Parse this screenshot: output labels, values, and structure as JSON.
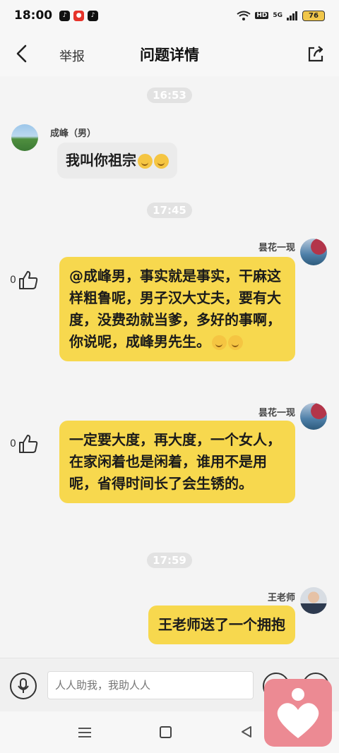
{
  "status": {
    "time": "18:00",
    "battery": "76",
    "hd": "HD",
    "signal": "5G"
  },
  "header": {
    "report_label": "举报",
    "title": "问题详情"
  },
  "timestamps": [
    "16:53",
    "17:45",
    "17:59"
  ],
  "messages": [
    {
      "sender": "成峰（男）",
      "text": "我叫你祖宗",
      "emoji_count": 2
    },
    {
      "sender": "昙花一现",
      "text": "@成峰男，事实就是事实，干麻这样粗鲁呢，男子汉大丈夫，要有大度，没费劲就当爹，多好的事啊，你说呢，成峰男先生。",
      "likes": "0",
      "emoji_count": 2
    },
    {
      "sender": "昙花一现",
      "text": "一定要大度，再大度，一个女人，在家闲着也是闲着，谁用不是用呢，省得时间长了会生锈的。",
      "likes": "0"
    },
    {
      "sender": "王老师",
      "text": "王老师送了一个拥抱"
    }
  ],
  "input": {
    "placeholder": "人人助我，我助人人"
  },
  "colors": {
    "bubble_yellow": "#f7d84e",
    "bubble_gray": "#ebebeb",
    "float_app": "#ec8a93"
  }
}
